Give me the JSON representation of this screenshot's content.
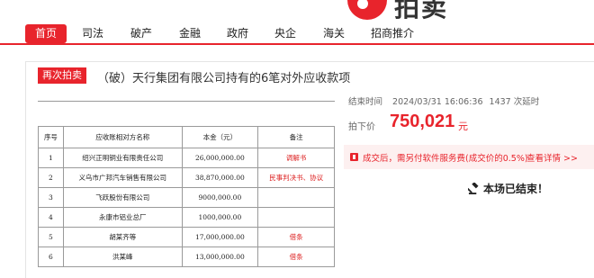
{
  "logo": {
    "text": "拍卖",
    "brand_color": "#e8242c"
  },
  "nav": {
    "items": [
      {
        "label": "首页",
        "active": true
      },
      {
        "label": "司法"
      },
      {
        "label": "破产"
      },
      {
        "label": "金融"
      },
      {
        "label": "政府"
      },
      {
        "label": "央企"
      },
      {
        "label": "海关"
      },
      {
        "label": "招商推介"
      }
    ]
  },
  "auction": {
    "badge": "再次拍卖",
    "title": "（破）天行集团有限公司持有的6笔对外应收款项",
    "end_label": "结束时间",
    "end_time": "2024/03/31 16:06:36",
    "delay_count": "1437",
    "delay_label": "次延时",
    "price_label": "拍下价",
    "price": "750,021",
    "price_unit": "元",
    "notice_text": "成交后，需另付软件服务费(成交价的0.5%)",
    "notice_link": "查看详情 >>",
    "status": "本场已结束！"
  },
  "table": {
    "headers": [
      "序号",
      "应收账相对方名称",
      "本金（元）",
      "备注"
    ],
    "rows": [
      [
        "1",
        "绍兴正明铜业有限责任公司",
        "26,000,000.00",
        "调解书"
      ],
      [
        "2",
        "义乌市广邦汽车销售有限公司",
        "38,870,000.00",
        "民事判决书、协议"
      ],
      [
        "3",
        "飞跃股份有限公司",
        "9000,000.00",
        ""
      ],
      [
        "4",
        "永康市铝业总厂",
        "1000,000.00",
        ""
      ],
      [
        "5",
        "胡某齐等",
        "17,000,000.00",
        "借条"
      ],
      [
        "6",
        "洪某峰",
        "13,000,000.00",
        "借条"
      ]
    ]
  }
}
